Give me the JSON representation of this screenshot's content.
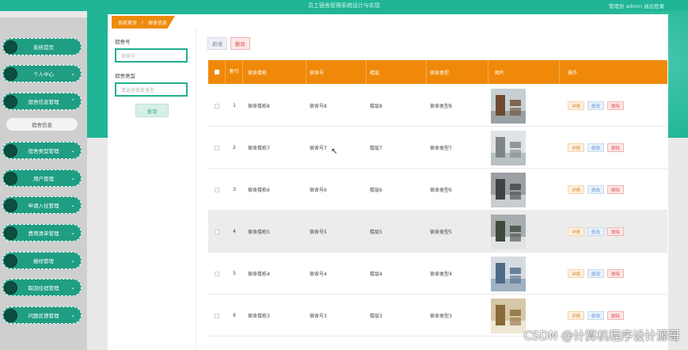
{
  "header": {
    "app_title": "员工宿舍管理系统设计与实现",
    "user_text": "管理员 admin  退出登录"
  },
  "breadcrumb": {
    "home": "系统首页",
    "separator": "/",
    "current": "宿舍信息"
  },
  "sidebar": {
    "items": [
      {
        "label": "系统首页",
        "chevron": ""
      },
      {
        "label": "个人中心",
        "chevron": "⌄"
      },
      {
        "label": "宿舍信息管理",
        "chevron": "⌃"
      },
      {
        "label": "宿舍类型管理",
        "chevron": "⌄"
      },
      {
        "label": "用户管理",
        "chevron": "⌄"
      },
      {
        "label": "申请入住管理",
        "chevron": "⌄"
      },
      {
        "label": "费用清单管理",
        "chevron": "⌄"
      },
      {
        "label": "报修管理",
        "chevron": "⌄"
      },
      {
        "label": "取回住宿管理",
        "chevron": "⌄"
      },
      {
        "label": "问题反馈管理",
        "chevron": "⌄"
      }
    ],
    "sub_item": "宿舍信息"
  },
  "search": {
    "field1_label": "宿舍号",
    "field1_placeholder": "宿舍号",
    "field2_label": "宿舍类型",
    "field2_placeholder": "请选择宿舍类型",
    "button": "查询"
  },
  "toolbar": {
    "add": "新增",
    "delete": "删除"
  },
  "table": {
    "headers": [
      "索引",
      "宿舍楼栋",
      "宿舍号",
      "楼层",
      "宿舍类型",
      "图片",
      "操作"
    ],
    "actions": {
      "detail": "详情",
      "edit": "修改",
      "remove": "删除"
    },
    "rows": [
      {
        "index": "1",
        "building": "宿舍楼栋8",
        "room": "宿舍号8",
        "floor": "楼层8",
        "type": "宿舍类型8"
      },
      {
        "index": "2",
        "building": "宿舍楼栋7",
        "room": "宿舍号7",
        "floor": "楼层7",
        "type": "宿舍类型7"
      },
      {
        "index": "3",
        "building": "宿舍楼栋6",
        "room": "宿舍号6",
        "floor": "楼层6",
        "type": "宿舍类型6"
      },
      {
        "index": "4",
        "building": "宿舍楼栋5",
        "room": "宿舍号5",
        "floor": "楼层5",
        "type": "宿舍类型5"
      },
      {
        "index": "5",
        "building": "宿舍楼栋4",
        "room": "宿舍号4",
        "floor": "楼层4",
        "type": "宿舍类型4"
      },
      {
        "index": "6",
        "building": "宿舍楼栋3",
        "room": "宿舍号3",
        "floor": "楼层3",
        "type": "宿舍类型3"
      }
    ]
  },
  "watermark": "CSDN @计算机程序设计源哥",
  "colors": {
    "teal": "#1fb596",
    "orange": "#f0890a",
    "nav": "#1f9e83"
  }
}
